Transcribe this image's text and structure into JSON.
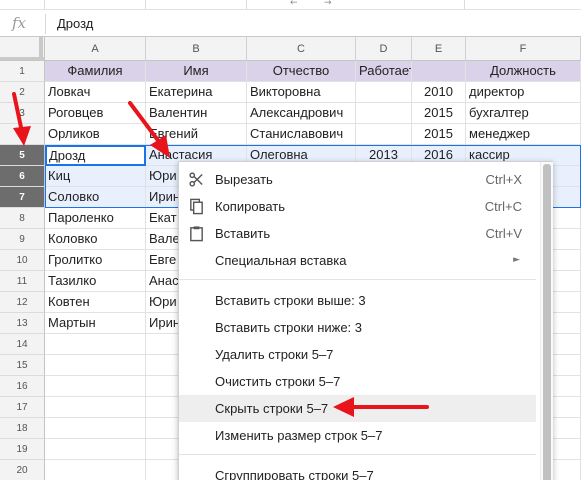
{
  "formula_bar": {
    "fx_label": "fx",
    "value": "Дрозд"
  },
  "columns": [
    "A",
    "B",
    "C",
    "D",
    "E",
    "F"
  ],
  "rows": [
    {
      "num": "1",
      "cells": [
        "Фамилия",
        "Имя",
        "Отчество",
        "Работает с...",
        "",
        "Должность"
      ]
    },
    {
      "num": "2",
      "cells": [
        "Ловкач",
        "Екатерина",
        "Викторовна",
        "",
        "2010",
        "директор"
      ]
    },
    {
      "num": "3",
      "cells": [
        "Роговцев",
        "Валентин",
        "Александрович",
        "",
        "2015",
        "бухгалтер"
      ]
    },
    {
      "num": "4",
      "cells": [
        "Орликов",
        "Евгений",
        "Станиславович",
        "",
        "2015",
        "менеджер"
      ]
    },
    {
      "num": "5",
      "cells": [
        "Дрозд",
        "Анастасия",
        "Олеговна",
        "2013",
        "2016",
        "кассир"
      ]
    },
    {
      "num": "6",
      "cells": [
        "Киц",
        "Юри",
        "",
        "",
        "",
        ""
      ]
    },
    {
      "num": "7",
      "cells": [
        "Соловко",
        "Ирин",
        "",
        "",
        "",
        ""
      ]
    },
    {
      "num": "8",
      "cells": [
        "Пароленко",
        "Екат",
        "",
        "",
        "",
        ""
      ]
    },
    {
      "num": "9",
      "cells": [
        "Коловко",
        "Вале",
        "",
        "",
        "",
        ""
      ]
    },
    {
      "num": "10",
      "cells": [
        "Гролитко",
        "Евге",
        "",
        "",
        "",
        ""
      ]
    },
    {
      "num": "11",
      "cells": [
        "Тазилко",
        "Анас",
        "",
        "",
        "",
        ""
      ]
    },
    {
      "num": "12",
      "cells": [
        "Ковтен",
        "Юри",
        "",
        "",
        "",
        ""
      ]
    },
    {
      "num": "13",
      "cells": [
        "Мартын",
        "Ирин",
        "",
        "",
        "",
        ""
      ]
    },
    {
      "num": "14",
      "cells": [
        "",
        "",
        "",
        "",
        "",
        ""
      ]
    },
    {
      "num": "15",
      "cells": [
        "",
        "",
        "",
        "",
        "",
        ""
      ]
    },
    {
      "num": "16",
      "cells": [
        "",
        "",
        "",
        "",
        "",
        ""
      ]
    },
    {
      "num": "17",
      "cells": [
        "",
        "",
        "",
        "",
        "",
        ""
      ]
    },
    {
      "num": "18",
      "cells": [
        "",
        "",
        "",
        "",
        "",
        ""
      ]
    },
    {
      "num": "19",
      "cells": [
        "",
        "",
        "",
        "",
        "",
        ""
      ]
    },
    {
      "num": "20",
      "cells": [
        "",
        "",
        "",
        "",
        "",
        ""
      ]
    }
  ],
  "context_menu": {
    "cut": {
      "label": "Вырезать",
      "shortcut": "Ctrl+X",
      "icon": "scissors-icon"
    },
    "copy": {
      "label": "Копировать",
      "shortcut": "Ctrl+C",
      "icon": "copy-icon"
    },
    "paste": {
      "label": "Вставить",
      "shortcut": "Ctrl+V",
      "icon": "clipboard-icon"
    },
    "paste_special": {
      "label": "Специальная вставка",
      "arrow": "►"
    },
    "insert_above": {
      "label": "Вставить строки выше: 3"
    },
    "insert_below": {
      "label": "Вставить строки ниже: 3"
    },
    "delete_rows": {
      "label": "Удалить строки 5–7"
    },
    "clear_rows": {
      "label": "Очистить строки 5–7"
    },
    "hide_rows": {
      "label": "Скрыть строки 5–7"
    },
    "resize_rows": {
      "label": "Изменить размер строк 5–7"
    },
    "group_rows": {
      "label": "Сгруппировать строки 5–7"
    }
  },
  "colors": {
    "header_fill": "#d9d2e9",
    "selection_fill": "#e8f0fe",
    "selection_border": "#1a73e8",
    "selected_row_header": "#6d6d6d",
    "annotation_arrow": "#e8141b"
  }
}
